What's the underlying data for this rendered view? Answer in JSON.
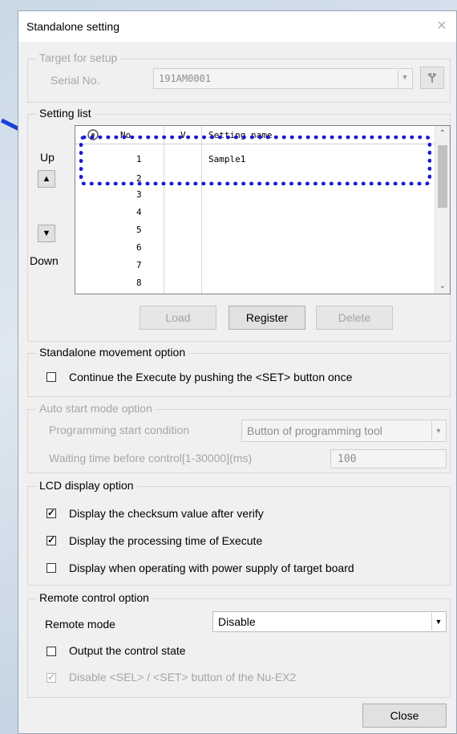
{
  "title": "Standalone setting",
  "close_glyph": "×",
  "target": {
    "legend": "Target for setup",
    "serial_label": "Serial No.",
    "serial_value": "191AM0001"
  },
  "setting_list": {
    "legend": "Setting list",
    "up_label": "Up",
    "down_label": "Down",
    "columns": [
      "No.",
      "V",
      "Setting name"
    ],
    "rows": [
      {
        "no": "1",
        "v": "",
        "name": "Sample1"
      },
      {
        "no": "2",
        "v": "",
        "name": ""
      },
      {
        "no": "3",
        "v": "",
        "name": ""
      },
      {
        "no": "4",
        "v": "",
        "name": ""
      },
      {
        "no": "5",
        "v": "",
        "name": ""
      },
      {
        "no": "6",
        "v": "",
        "name": ""
      },
      {
        "no": "7",
        "v": "",
        "name": ""
      },
      {
        "no": "8",
        "v": "",
        "name": ""
      }
    ],
    "load_label": "Load",
    "register_label": "Register",
    "delete_label": "Delete"
  },
  "movement": {
    "legend": "Standalone movement option",
    "continue_label": "Continue the Execute by pushing the <SET> button once",
    "continue_checked": false
  },
  "auto_start": {
    "legend": "Auto start mode option",
    "condition_label": "Programming start condition",
    "condition_value": "Button of programming tool",
    "wait_label": "Waiting time before control[1-30000](ms)",
    "wait_value": "100"
  },
  "lcd": {
    "legend": "LCD display option",
    "items": [
      {
        "label": "Display the checksum value after verify",
        "checked": true
      },
      {
        "label": "Display the processing time of Execute",
        "checked": true
      },
      {
        "label": "Display when operating with power supply of target board",
        "checked": false
      }
    ]
  },
  "remote": {
    "legend": "Remote control option",
    "mode_label": "Remote mode",
    "mode_value": "Disable",
    "output_label": "Output the control state",
    "output_checked": false,
    "disable_label": "Disable <SEL> / <SET> button of the Nu-EX2",
    "disable_checked": true
  },
  "close_label": "Close",
  "check_glyph": "✓",
  "colors": {
    "highlight": "#1a1ad6",
    "arrow": "#1a3fd6"
  }
}
